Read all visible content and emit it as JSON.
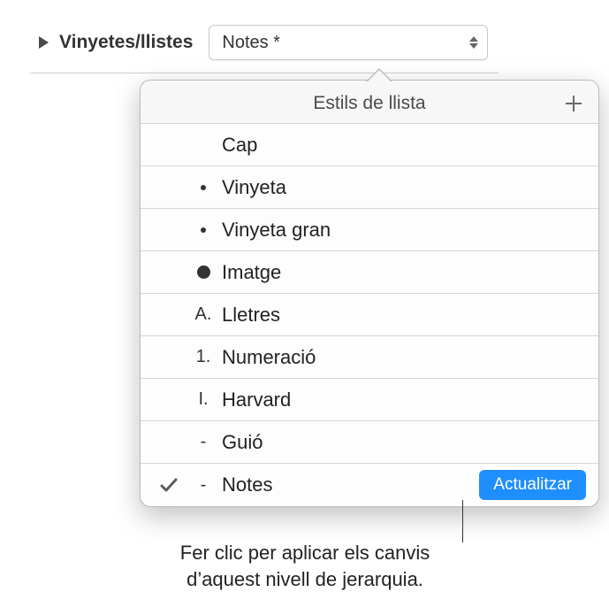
{
  "section": {
    "label": "Vinyetes/llistes",
    "selected_value": "Notes *"
  },
  "popover": {
    "title": "Estils de llista",
    "items": [
      {
        "marker": "",
        "label": "Cap",
        "checked": false
      },
      {
        "marker": "•",
        "label": "Vinyeta",
        "checked": false
      },
      {
        "marker": "•",
        "label": "Vinyeta gran",
        "checked": false
      },
      {
        "marker": "●",
        "label": "Imatge",
        "checked": false
      },
      {
        "marker": "A.",
        "label": "Lletres",
        "checked": false
      },
      {
        "marker": "1.",
        "label": "Numeració",
        "checked": false
      },
      {
        "marker": "I.",
        "label": "Harvard",
        "checked": false
      },
      {
        "marker": "-",
        "label": "Guió",
        "checked": false
      },
      {
        "marker": "-",
        "label": "Notes",
        "checked": true
      }
    ],
    "update_label": "Actualitzar"
  },
  "callout": {
    "line1": "Fer clic per aplicar els canvis",
    "line2": "d’aquest nivell de jerarquia."
  }
}
